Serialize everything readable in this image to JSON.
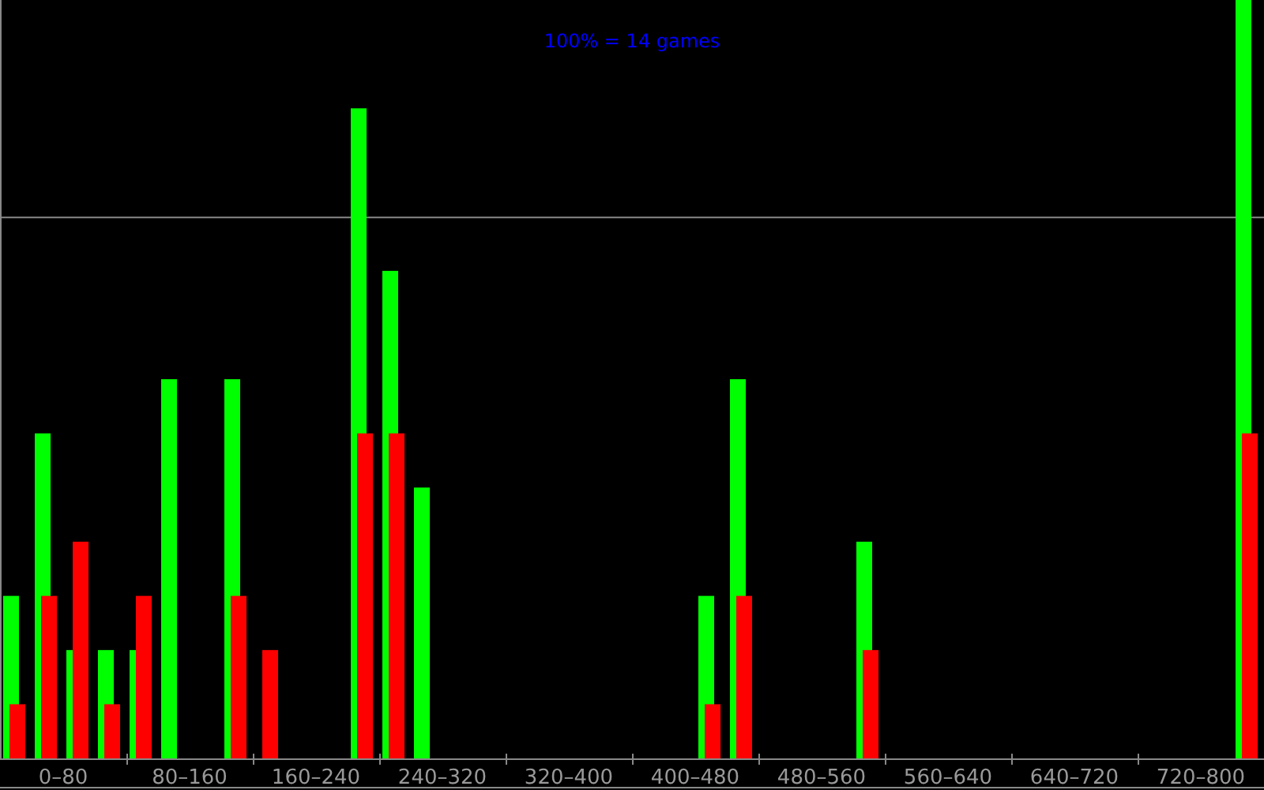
{
  "chart": {
    "title": "100% = 14 games",
    "x_labels": [
      "0–80",
      "80–160",
      "160–240",
      "240–320",
      "320–400",
      "400–480",
      "480–560",
      "560–640",
      "640–720",
      "720–800"
    ]
  }
}
